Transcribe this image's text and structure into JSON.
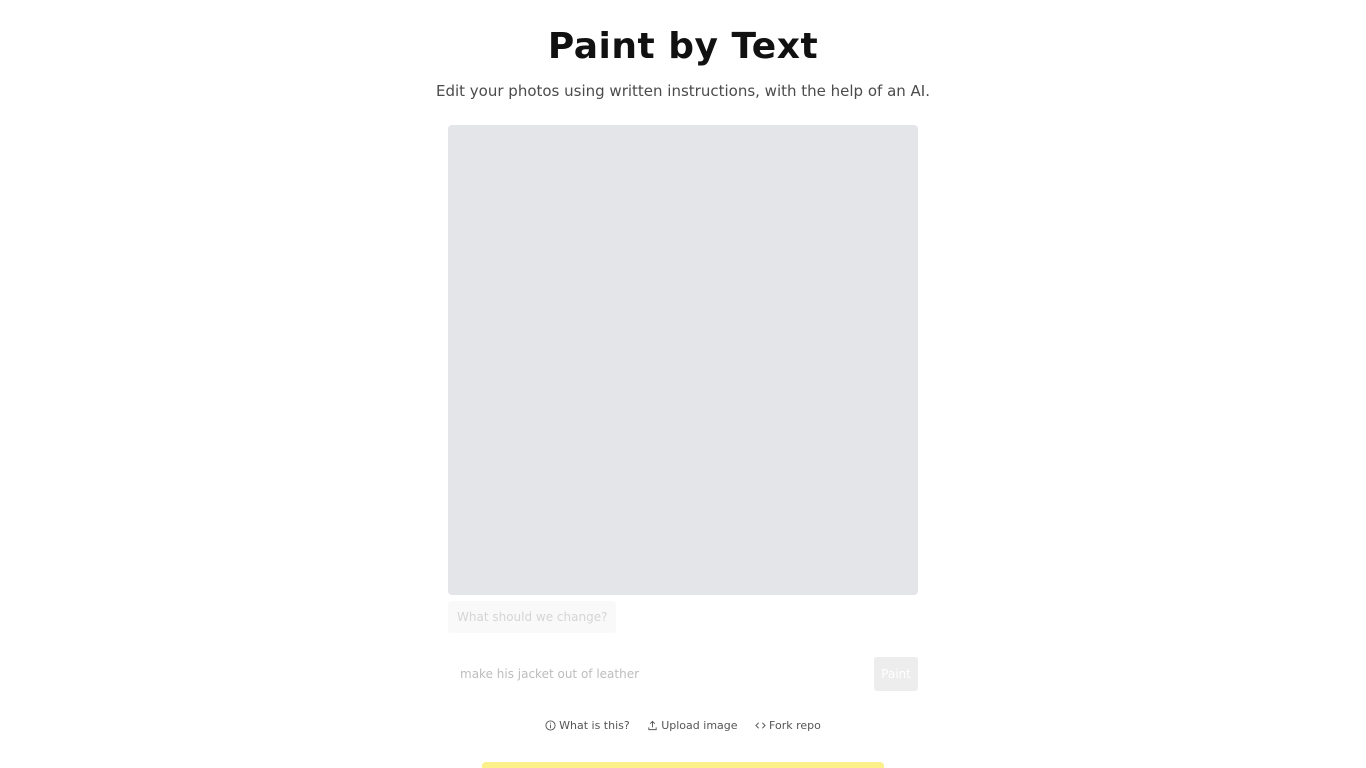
{
  "header": {
    "title": "Paint by Text",
    "subtitle": "Edit your photos using written instructions, with the help of an AI."
  },
  "prompt": {
    "question": "What should we change?",
    "placeholder": "make his jacket out of leather",
    "value": ""
  },
  "actions": {
    "paint_label": "Paint"
  },
  "footer": {
    "links": [
      {
        "label": "What is this?",
        "icon": "info-icon"
      },
      {
        "label": "Upload image",
        "icon": "upload-icon"
      },
      {
        "label": "Fork repo",
        "icon": "code-icon"
      }
    ]
  },
  "colors": {
    "canvas_bg": "#e4e5e9",
    "banner": "#fbf08a",
    "button_bg": "#ededee"
  }
}
